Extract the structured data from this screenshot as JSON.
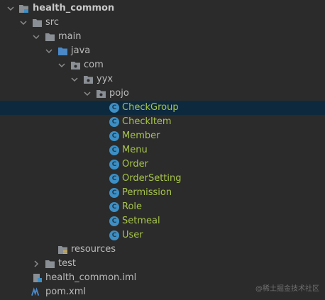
{
  "tree": {
    "root": "health_common",
    "src": "src",
    "main": "main",
    "java": "java",
    "com": "com",
    "yyx": "yyx",
    "pojo": "pojo",
    "classes": [
      "CheckGroup",
      "CheckItem",
      "Member",
      "Menu",
      "Order",
      "OrderSetting",
      "Permission",
      "Role",
      "Setmeal",
      "User"
    ],
    "resources": "resources",
    "test": "test",
    "iml": "health_common.iml",
    "pom": "pom.xml"
  },
  "selected_item": "CheckGroup",
  "watermark": "@稀土掘金技术社区",
  "colors": {
    "background": "#2b2b2b",
    "selection": "#0d293e",
    "class_icon": "#3d8fc5",
    "class_text": "#a7c54a",
    "text": "#bbbbbb"
  }
}
